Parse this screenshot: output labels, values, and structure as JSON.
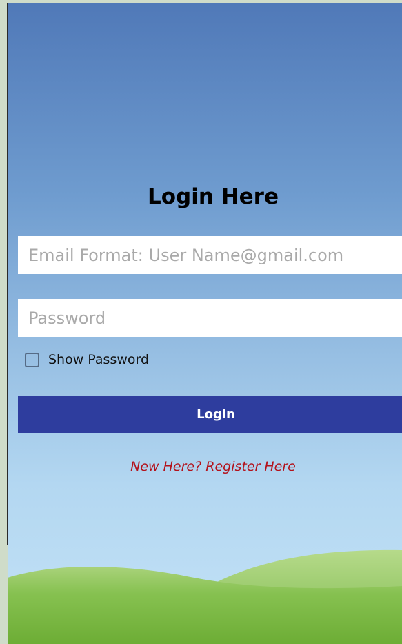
{
  "login": {
    "title": "Login Here",
    "email_placeholder": "Email Format: User Name@gmail.com",
    "password_placeholder": "Password",
    "show_password_label": "Show Password",
    "show_password_checked": false,
    "login_label": "Login",
    "register_label": "New Here? Register Here"
  },
  "colors": {
    "sky_top": "#5079b8",
    "sky_bottom": "#c3e2f6",
    "button": "#2e3d9e",
    "register_link": "#b3121b",
    "hill_green": "#7ab84a"
  }
}
